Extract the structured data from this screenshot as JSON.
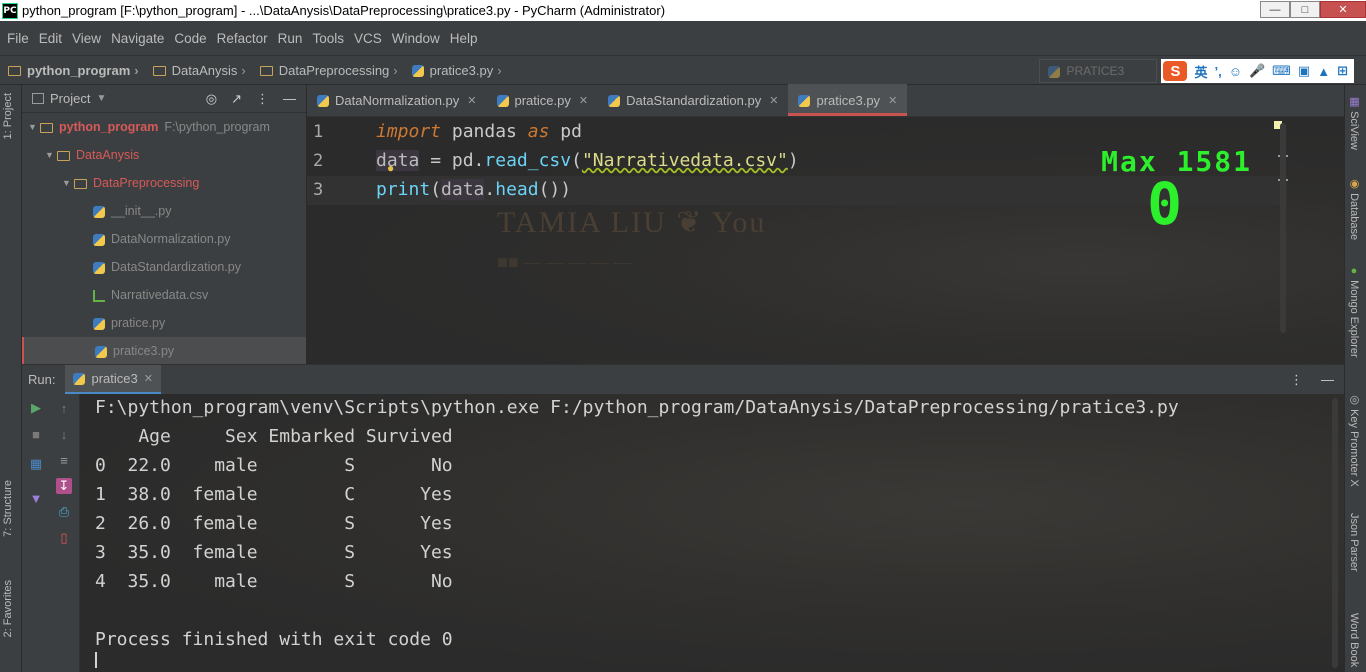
{
  "titlebar": {
    "app_icon": "PC",
    "title": "python_program [F:\\python_program] - ...\\DataAnysis\\DataPreprocessing\\pratice3.py - PyCharm (Administrator)",
    "buttons": [
      "minimize",
      "maximize",
      "close"
    ]
  },
  "menu": [
    "File",
    "Edit",
    "View",
    "Navigate",
    "Code",
    "Refactor",
    "Run",
    "Tools",
    "VCS",
    "Window",
    "Help"
  ],
  "breadcrumb": [
    "python_program",
    "DataAnysis",
    "DataPreprocessing",
    "pratice3.py"
  ],
  "run_config": "PRATICE3",
  "ime": {
    "logo": "S",
    "lang": "英"
  },
  "left_strip": {
    "project_tab": "1: Project",
    "structure_tab": "7: Structure",
    "favorites_tab": "2: Favorites"
  },
  "right_strip": [
    "SciView",
    "Database",
    "Mongo Explorer",
    "Key Promoter X",
    "Json Parser",
    "Word Book"
  ],
  "project_panel": {
    "title": "Project",
    "tree": [
      {
        "name": "python_program",
        "path": "F:\\python_program",
        "level": 0,
        "type": "folder",
        "expanded": true
      },
      {
        "name": "DataAnysis",
        "level": 1,
        "type": "folder",
        "expanded": true
      },
      {
        "name": "DataPreprocessing",
        "level": 2,
        "type": "folder",
        "expanded": true
      },
      {
        "name": "__init__.py",
        "level": 3,
        "type": "py"
      },
      {
        "name": "DataNormalization.py",
        "level": 3,
        "type": "py"
      },
      {
        "name": "DataStandardization.py",
        "level": 3,
        "type": "py"
      },
      {
        "name": "Narrativedata.csv",
        "level": 3,
        "type": "csv"
      },
      {
        "name": "pratice.py",
        "level": 3,
        "type": "py"
      },
      {
        "name": "pratice3.py",
        "level": 3,
        "type": "py",
        "selected": true
      }
    ]
  },
  "editor_tabs": [
    {
      "label": "DataNormalization.py",
      "active": false
    },
    {
      "label": "pratice.py",
      "active": false
    },
    {
      "label": "DataStandardization.py",
      "active": false
    },
    {
      "label": "pratice3.py",
      "active": true
    }
  ],
  "editor": {
    "line_numbers": [
      "1",
      "2",
      "3"
    ],
    "line1": {
      "kw1": "import",
      "mod": " pandas ",
      "kw2": "as",
      "alias": " pd"
    },
    "line2": {
      "var": "data",
      "eq": " = pd.",
      "fn": "read_csv",
      "open": "(",
      "str": "\"Narrativedata.csv\"",
      "close": ")"
    },
    "line3": {
      "fn": "print",
      "open": "(",
      "var": "data",
      "dot": ".",
      "method": "head",
      "close": "())"
    },
    "overlay": {
      "max_label": "Max  1581",
      "big_value": "0"
    }
  },
  "run_panel": {
    "label": "Run:",
    "tab": "pratice3",
    "console": [
      "F:\\python_program\\venv\\Scripts\\python.exe F:/python_program/DataAnysis/DataPreprocessing/pratice3.py",
      "    Age     Sex Embarked Survived",
      "0  22.0    male        S       No",
      "1  38.0  female        C      Yes",
      "2  26.0  female        S      Yes",
      "3  35.0  female        S      Yes",
      "4  35.0    male        S       No",
      "",
      "Process finished with exit code 0"
    ]
  },
  "colors": {
    "accent_red": "#c75450",
    "score_green": "#2cf02c",
    "run_tab_underline": "#4a88c7"
  }
}
